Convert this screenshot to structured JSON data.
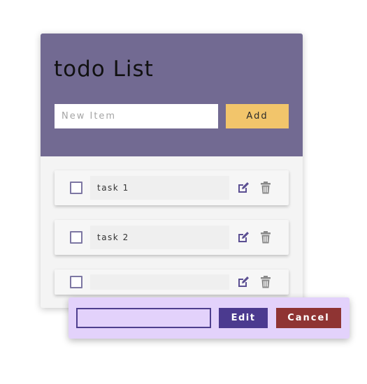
{
  "header": {
    "title": "todo List",
    "color": "#726a92"
  },
  "new_item": {
    "placeholder": "New Item",
    "value": "",
    "add_label": "Add",
    "add_color": "#f2c56b"
  },
  "tasks": [
    {
      "text": "task 1",
      "done": false
    },
    {
      "text": "task 2",
      "done": false
    },
    {
      "text": "",
      "done": false
    }
  ],
  "icons": {
    "edit": "edit-icon",
    "delete": "trash-icon",
    "edit_color": "#5b4f92",
    "delete_color": "#8a8a8a"
  },
  "edit_panel": {
    "value": "",
    "edit_label": "Edit",
    "cancel_label": "Cancel",
    "background": "#e3d2fb",
    "edit_color": "#4b3a8f",
    "cancel_color": "#8f3433"
  }
}
